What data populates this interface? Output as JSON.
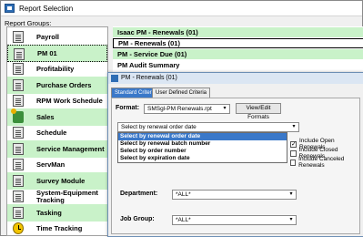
{
  "window": {
    "title": "Report Selection",
    "groups_label": "Report Groups:"
  },
  "groups": [
    {
      "label": "Payroll",
      "icon": "document-icon",
      "alt": false
    },
    {
      "label": "PM 01",
      "icon": "document-icon",
      "alt": true,
      "selected": true
    },
    {
      "label": "Profitability",
      "icon": "document-icon",
      "alt": false
    },
    {
      "label": "Purchase Orders",
      "icon": "document-icon",
      "alt": true
    },
    {
      "label": "RPM Work Schedule",
      "icon": "document-icon",
      "alt": false
    },
    {
      "label": "Sales",
      "icon": "people-icon",
      "alt": true
    },
    {
      "label": "Schedule",
      "icon": "document-icon",
      "alt": false
    },
    {
      "label": "Service Management",
      "icon": "document-icon",
      "alt": true
    },
    {
      "label": "ServMan",
      "icon": "document-icon",
      "alt": false
    },
    {
      "label": "Survey Module",
      "icon": "document-icon",
      "alt": true
    },
    {
      "label": "System-Equipment Tracking",
      "icon": "document-icon",
      "alt": false
    },
    {
      "label": "Tasking",
      "icon": "document-icon",
      "alt": true
    },
    {
      "label": "Time Tracking",
      "icon": "clock-icon",
      "alt": false
    }
  ],
  "reports": [
    {
      "label": "Isaac PM - Renewals (01)",
      "alt": true
    },
    {
      "label": "PM - Renewals (01)",
      "alt": false,
      "selected": true
    },
    {
      "label": "PM - Service Due (01)",
      "alt": true
    },
    {
      "label": "PM Audit Summary",
      "alt": false
    }
  ],
  "dialog": {
    "title": "PM - Renewals (01)",
    "tabs": [
      "Standard Criteria",
      "User Defined Criteria"
    ],
    "format_label": "Format:",
    "format_value": "SMSgl-PM Renewals.rpt",
    "view_edit_button": "View/Edit Formats",
    "sort_value": "Select by renewal order date",
    "sort_options": [
      "Select by renewal order date",
      "Select by renewal batch number",
      "Select by order number",
      "Select by expiration date"
    ],
    "checkboxes": [
      {
        "label": "Include Open Renewals",
        "checked": true
      },
      {
        "label": "Include Closed Renewals",
        "checked": false
      },
      {
        "label": "Include Canceled Renewals",
        "checked": false
      }
    ],
    "department_label": "Department:",
    "department_value": "*ALL*",
    "job_group_label": "Job Group:",
    "job_group_value": "*ALL*"
  },
  "colors": {
    "alt_row": "#c9f2c9",
    "highlight": "#3a78c9"
  }
}
